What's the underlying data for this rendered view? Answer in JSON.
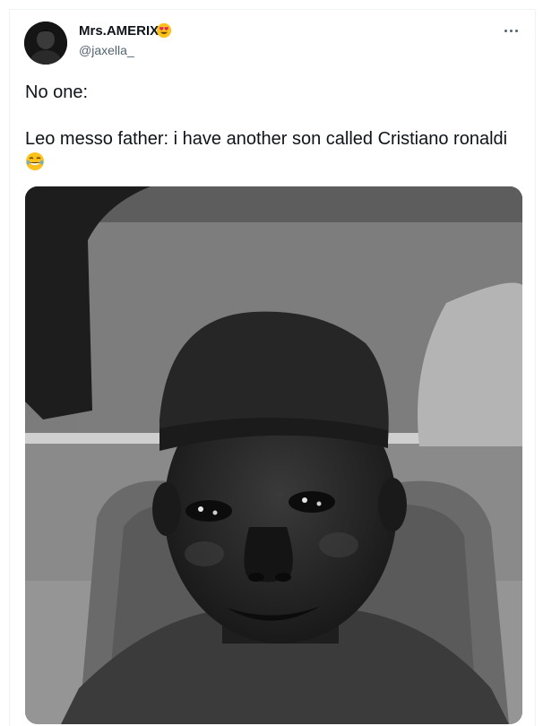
{
  "tweet": {
    "display_name": "Mrs.AMERIX",
    "name_emoji_icon": "heart-eyes-emoji-icon",
    "handle": "@jaxella_",
    "more_icon": "ellipsis-icon",
    "text_line1": "No one:",
    "text_line2": "Leo messo father: i have another son called Cristiano ronaldi",
    "text_emoji_icon": "tears-of-joy-emoji-icon",
    "media_icon": "photo-of-man-in-cap"
  },
  "colors": {
    "text": "#0f1419",
    "secondary_text": "#536471",
    "border": "#eff3f4"
  }
}
